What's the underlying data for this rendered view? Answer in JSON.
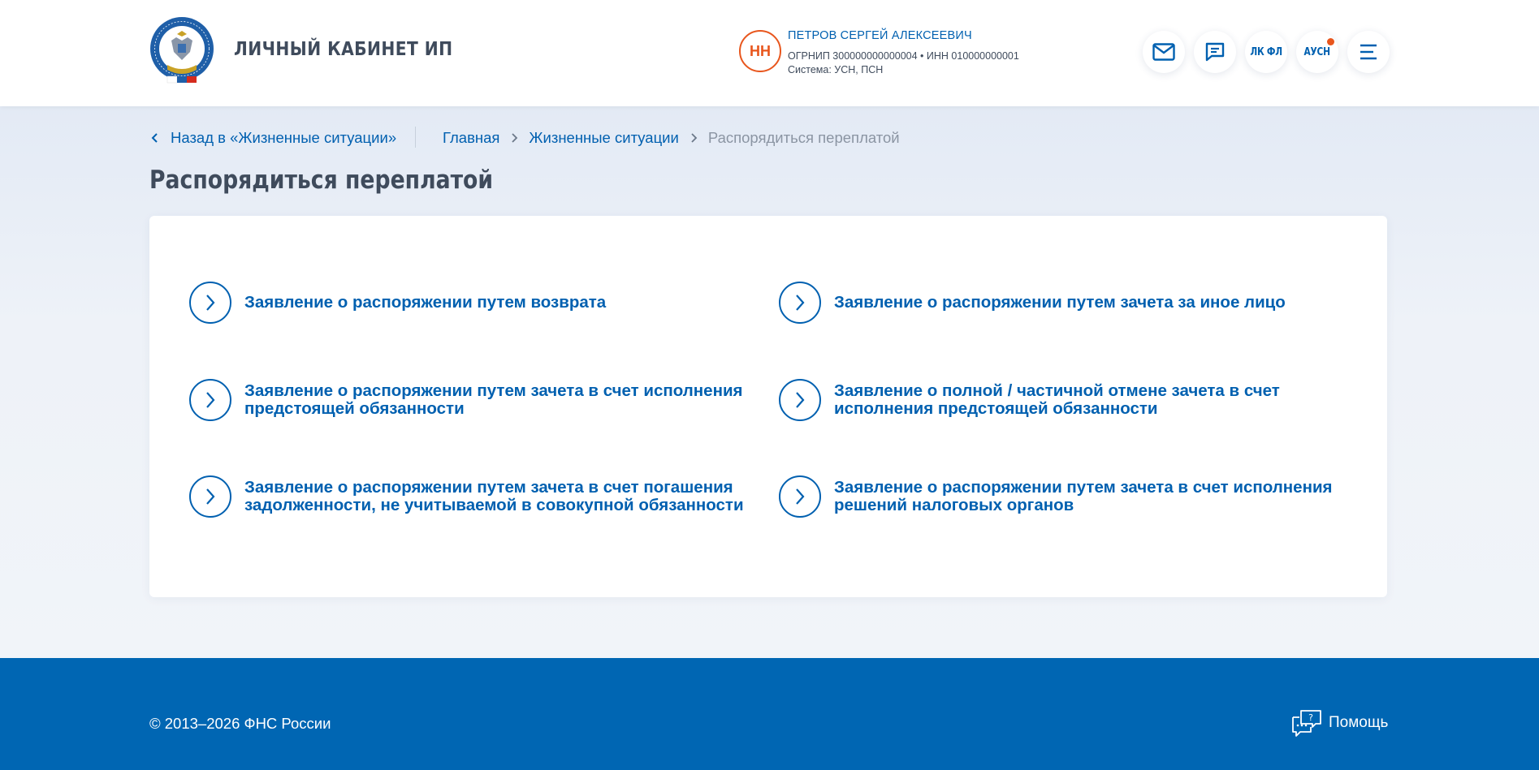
{
  "header": {
    "app_title": "ЛИЧНЫЙ КАБИНЕТ ИП",
    "logo_icon": "fns-emblem-icon",
    "user": {
      "initials": "НН",
      "name": "ПЕТРОВ СЕРГЕЙ АЛЕКСЕЕВИЧ",
      "ids": "ОГРНИП 300000000000004 • ИНН 010000000001",
      "system": "Система: УСН, ПСН"
    },
    "buttons": {
      "mail_icon": "mail-icon",
      "chat_icon": "chat-icon",
      "lk_fl": "ЛК ФЛ",
      "ausn": "АУСН",
      "menu_icon": "hamburger-menu-icon"
    }
  },
  "nav": {
    "back_label": "Назад в «Жизненные ситуации»",
    "breadcrumbs": [
      "Главная",
      "Жизненные ситуации",
      "Распорядиться переплатой"
    ]
  },
  "page": {
    "title": "Распорядиться переплатой",
    "options": [
      "Заявление о распоряжении путем возврата",
      "Заявление о распоряжении путем зачета за иное лицо",
      "Заявление о распоряжении путем зачета в счет исполнения предстоящей обязанности",
      "Заявление о полной / частичной отмене зачета в счет исполнения предстоящей обязанности",
      "Заявление о распоряжении путем зачета в счет погашения задолженности, не учитываемой в совокупной обязанности",
      "Заявление о распоряжении путем зачета в счет исполнения решений налоговых органов"
    ]
  },
  "footer": {
    "copyright": "© 2013–2026 ФНС России",
    "help_label": "Помощь",
    "help_icon": "help-chat-icon"
  },
  "colors": {
    "primary": "#0060b0",
    "footer": "#0066b3",
    "accent": "#e8561d",
    "text_dark": "#3f4b5c",
    "muted": "#8b95a3"
  }
}
